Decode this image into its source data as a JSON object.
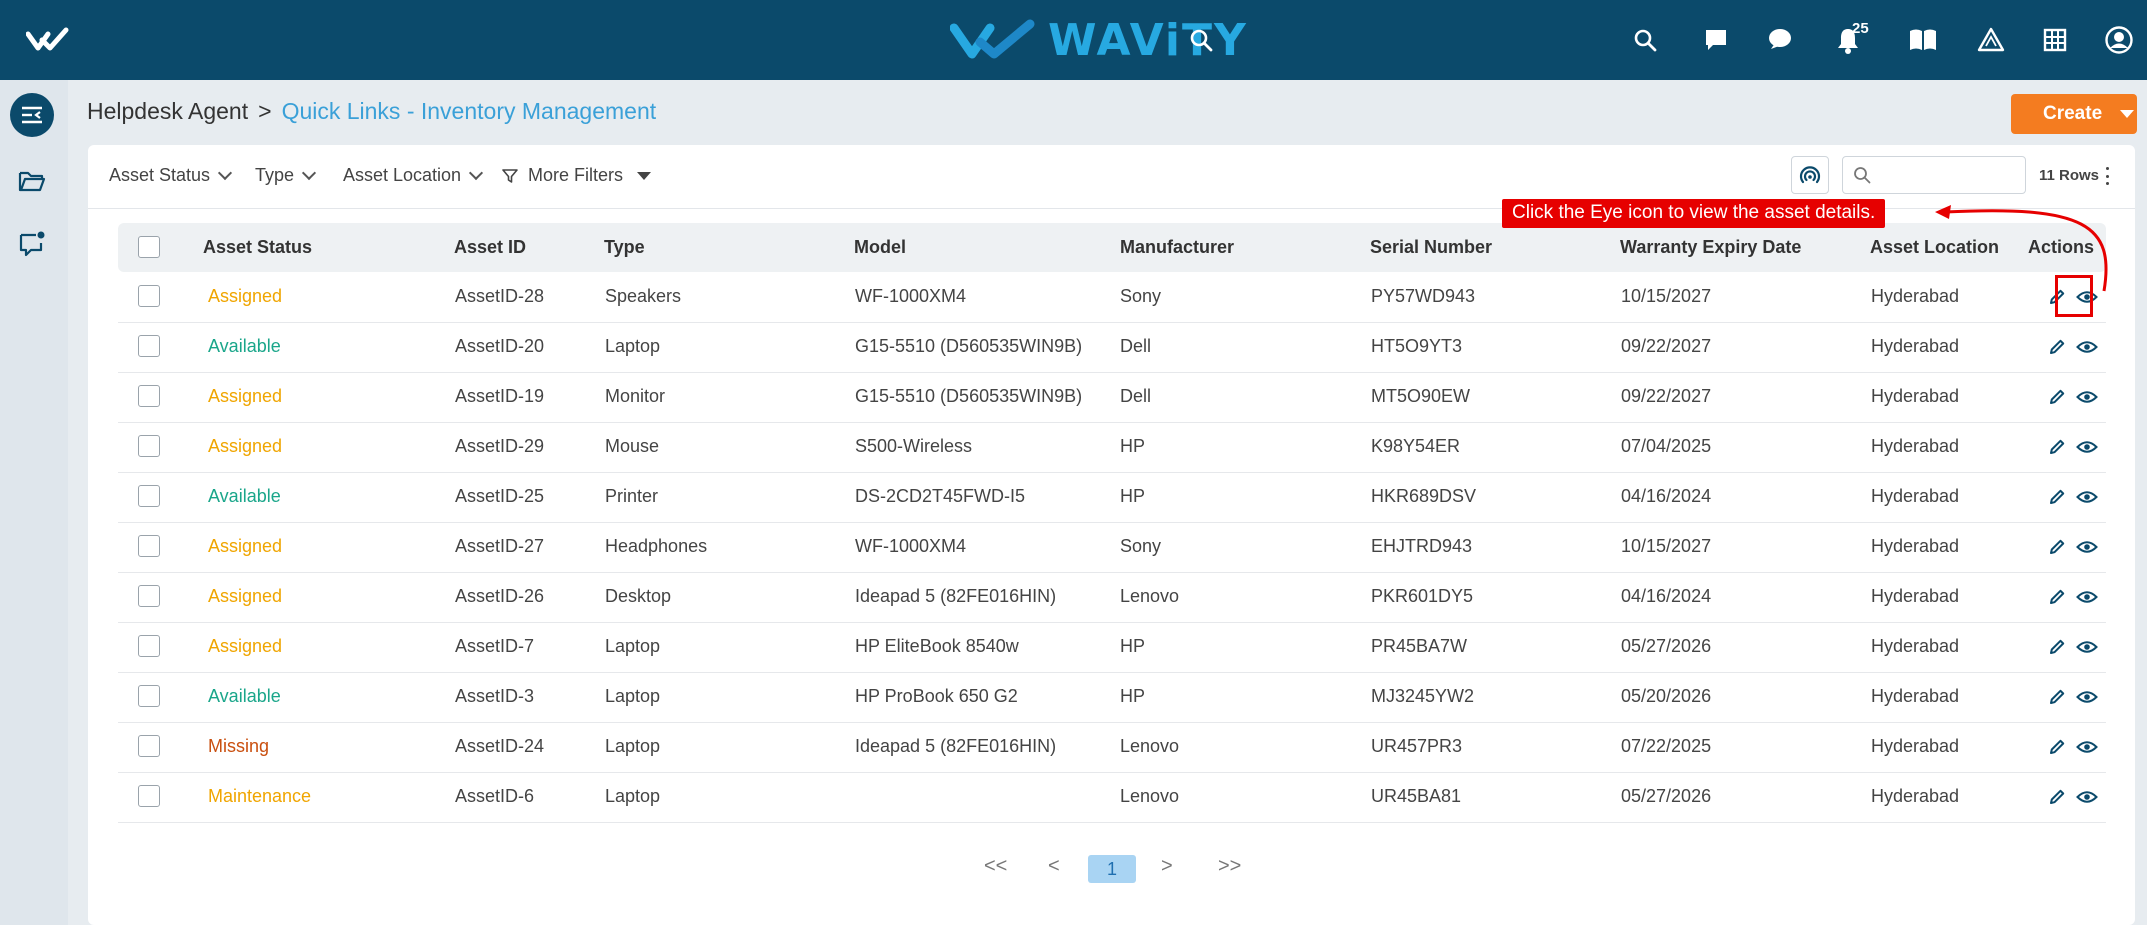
{
  "app": {
    "brand": "WAViTY",
    "notification_count": "25"
  },
  "breadcrumb": {
    "root": "Helpdesk Agent",
    "separator": ">",
    "current": "Quick Links - Inventory Management"
  },
  "toolbar": {
    "create_label": "Create"
  },
  "filters": {
    "asset_status": "Asset Status",
    "type": "Type",
    "asset_location": "Asset Location",
    "more_filters": "More Filters",
    "search_placeholder": "",
    "rows_label": "11 Rows"
  },
  "table": {
    "columns": [
      "Asset Status",
      "Asset ID",
      "Type",
      "Model",
      "Manufacturer",
      "Serial Number",
      "Warranty Expiry Date",
      "Asset Location",
      "Actions"
    ],
    "rows": [
      {
        "status": "Assigned",
        "asset_id": "AssetID-28",
        "type": "Speakers",
        "model": "WF-1000XM4",
        "manufacturer": "Sony",
        "serial": "PY57WD943",
        "warranty": "10/15/2027",
        "location": "Hyderabad"
      },
      {
        "status": "Available",
        "asset_id": "AssetID-20",
        "type": "Laptop",
        "model": "G15-5510 (D560535WIN9B)",
        "manufacturer": "Dell",
        "serial": "HT5O9YT3",
        "warranty": "09/22/2027",
        "location": "Hyderabad"
      },
      {
        "status": "Assigned",
        "asset_id": "AssetID-19",
        "type": "Monitor",
        "model": "G15-5510 (D560535WIN9B)",
        "manufacturer": "Dell",
        "serial": "MT5O90EW",
        "warranty": "09/22/2027",
        "location": "Hyderabad"
      },
      {
        "status": "Assigned",
        "asset_id": "AssetID-29",
        "type": "Mouse",
        "model": "S500-Wireless",
        "manufacturer": "HP",
        "serial": "K98Y54ER",
        "warranty": "07/04/2025",
        "location": "Hyderabad"
      },
      {
        "status": "Available",
        "asset_id": "AssetID-25",
        "type": "Printer",
        "model": "DS-2CD2T45FWD-I5",
        "manufacturer": "HP",
        "serial": "HKR689DSV",
        "warranty": "04/16/2024",
        "location": "Hyderabad"
      },
      {
        "status": "Assigned",
        "asset_id": "AssetID-27",
        "type": "Headphones",
        "model": "WF-1000XM4",
        "manufacturer": "Sony",
        "serial": "EHJTRD943",
        "warranty": "10/15/2027",
        "location": "Hyderabad"
      },
      {
        "status": "Assigned",
        "asset_id": "AssetID-26",
        "type": "Desktop",
        "model": "Ideapad 5 (82FE016HIN)",
        "manufacturer": "Lenovo",
        "serial": "PKR601DY5",
        "warranty": "04/16/2024",
        "location": "Hyderabad"
      },
      {
        "status": "Assigned",
        "asset_id": "AssetID-7",
        "type": "Laptop",
        "model": "HP EliteBook 8540w",
        "manufacturer": "HP",
        "serial": "PR45BA7W",
        "warranty": "05/27/2026",
        "location": "Hyderabad"
      },
      {
        "status": "Available",
        "asset_id": "AssetID-3",
        "type": "Laptop",
        "model": "HP ProBook 650 G2",
        "manufacturer": "HP",
        "serial": "MJ3245YW2",
        "warranty": "05/20/2026",
        "location": "Hyderabad"
      },
      {
        "status": "Missing",
        "asset_id": "AssetID-24",
        "type": "Laptop",
        "model": "Ideapad 5 (82FE016HIN)",
        "manufacturer": "Lenovo",
        "serial": "UR457PR3",
        "warranty": "07/22/2025",
        "location": "Hyderabad"
      },
      {
        "status": "Maintenance",
        "asset_id": "AssetID-6",
        "type": "Laptop",
        "model": "",
        "manufacturer": "Lenovo",
        "serial": "UR45BA81",
        "warranty": "05/27/2026",
        "location": "Hyderabad"
      }
    ]
  },
  "status_colors": {
    "Assigned": "#f0a500",
    "Available": "#1aa68a",
    "Missing": "#c94f0f",
    "Maintenance": "#f0a500"
  },
  "pagination": {
    "first": "<<",
    "prev": "<",
    "current": "1",
    "next": ">",
    "last": ">>"
  },
  "annotation": {
    "text": "Click the Eye icon to view the asset details."
  },
  "colors": {
    "topbar": "#0b4a6b",
    "accent": "#f47c20",
    "link": "#3aa0d8",
    "annotation": "#e60000"
  }
}
